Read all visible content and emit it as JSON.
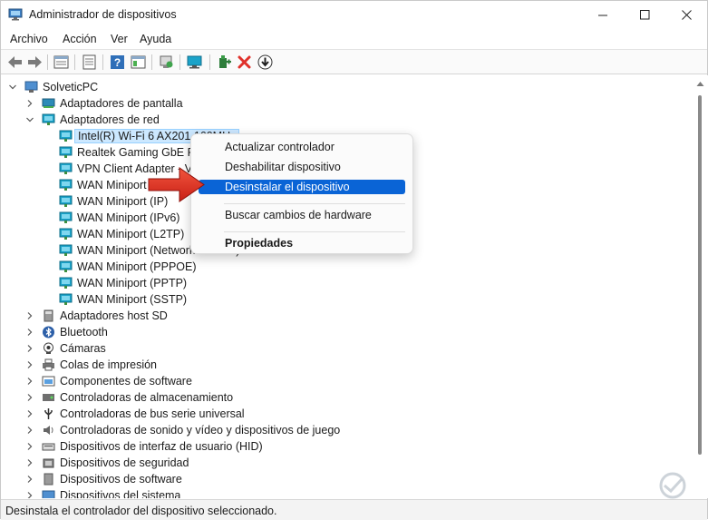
{
  "window": {
    "title": "Administrador de dispositivos",
    "controls": [
      "minimize",
      "maximize",
      "close"
    ]
  },
  "menubar": [
    "Archivo",
    "Acción",
    "Ver",
    "Ayuda"
  ],
  "toolbar": {
    "buttons": [
      "back-icon",
      "forward-icon",
      "properties-grid-icon",
      "list-icon",
      "help-icon",
      "grid-properties-icon",
      "refresh-icon",
      "monitor-icon",
      "add-driver-icon",
      "uninstall-icon",
      "download-icon"
    ]
  },
  "tree": {
    "root": "SolveticPC",
    "rows": [
      {
        "label": "SolveticPC",
        "level": 0,
        "expanded": true,
        "icon": "computer-icon"
      },
      {
        "label": "Adaptadores de pantalla",
        "level": 1,
        "expanded": false,
        "icon": "display-adapter-icon"
      },
      {
        "label": "Adaptadores de red",
        "level": 1,
        "expanded": true,
        "icon": "network-adapter-icon"
      },
      {
        "label": "Intel(R) Wi-Fi 6 AX201 160MHz",
        "level": 2,
        "icon": "network-adapter-icon",
        "selected": true
      },
      {
        "label": "Realtek Gaming GbE Family Controller",
        "level": 2,
        "icon": "network-adapter-icon"
      },
      {
        "label": "VPN Client Adapter - VPN",
        "level": 2,
        "icon": "network-adapter-icon"
      },
      {
        "label": "WAN Miniport (IKEv2)",
        "level": 2,
        "icon": "network-adapter-icon"
      },
      {
        "label": "WAN Miniport (IP)",
        "level": 2,
        "icon": "network-adapter-icon"
      },
      {
        "label": "WAN Miniport (IPv6)",
        "level": 2,
        "icon": "network-adapter-icon"
      },
      {
        "label": "WAN Miniport (L2TP)",
        "level": 2,
        "icon": "network-adapter-icon"
      },
      {
        "label": "WAN Miniport (Network Monitor)",
        "level": 2,
        "icon": "network-adapter-icon"
      },
      {
        "label": "WAN Miniport (PPPOE)",
        "level": 2,
        "icon": "network-adapter-icon"
      },
      {
        "label": "WAN Miniport (PPTP)",
        "level": 2,
        "icon": "network-adapter-icon"
      },
      {
        "label": "WAN Miniport (SSTP)",
        "level": 2,
        "icon": "network-adapter-icon"
      },
      {
        "label": "Adaptadores host SD",
        "level": 1,
        "expanded": false,
        "icon": "sd-host-icon"
      },
      {
        "label": "Bluetooth",
        "level": 1,
        "expanded": false,
        "icon": "bluetooth-icon"
      },
      {
        "label": "Cámaras",
        "level": 1,
        "expanded": false,
        "icon": "camera-icon"
      },
      {
        "label": "Colas de impresión",
        "level": 1,
        "expanded": false,
        "icon": "printer-icon"
      },
      {
        "label": "Componentes de software",
        "level": 1,
        "expanded": false,
        "icon": "software-component-icon"
      },
      {
        "label": "Controladoras de almacenamiento",
        "level": 1,
        "expanded": false,
        "icon": "storage-controller-icon"
      },
      {
        "label": "Controladoras de bus serie universal",
        "level": 1,
        "expanded": false,
        "icon": "usb-icon"
      },
      {
        "label": "Controladoras de sonido y vídeo y dispositivos de juego",
        "level": 1,
        "expanded": false,
        "icon": "speaker-icon"
      },
      {
        "label": "Dispositivos de interfaz de usuario (HID)",
        "level": 1,
        "expanded": false,
        "icon": "hid-icon"
      },
      {
        "label": "Dispositivos de seguridad",
        "level": 1,
        "expanded": false,
        "icon": "security-device-icon"
      },
      {
        "label": "Dispositivos de software",
        "level": 1,
        "expanded": false,
        "icon": "software-device-icon"
      },
      {
        "label": "Dispositivos del sistema",
        "level": 1,
        "expanded": false,
        "icon": "system-device-icon"
      }
    ]
  },
  "context_menu": {
    "items": [
      {
        "label": "Actualizar controlador",
        "highlighted": false,
        "bold": false
      },
      {
        "label": "Deshabilitar dispositivo",
        "highlighted": false,
        "bold": false
      },
      {
        "label": "Desinstalar el dispositivo",
        "highlighted": true,
        "bold": false
      },
      {
        "separator": true
      },
      {
        "label": "Buscar cambios de hardware",
        "highlighted": false,
        "bold": false
      },
      {
        "separator": true
      },
      {
        "label": "Propiedades",
        "highlighted": false,
        "bold": true
      }
    ]
  },
  "status": "Desinstala el controlador del dispositivo seleccionado.",
  "colors": {
    "accent": "#0a64d6",
    "selection": "#cce8ff",
    "arrow": "#e8382c",
    "network_icon": "#1ba3c9"
  }
}
